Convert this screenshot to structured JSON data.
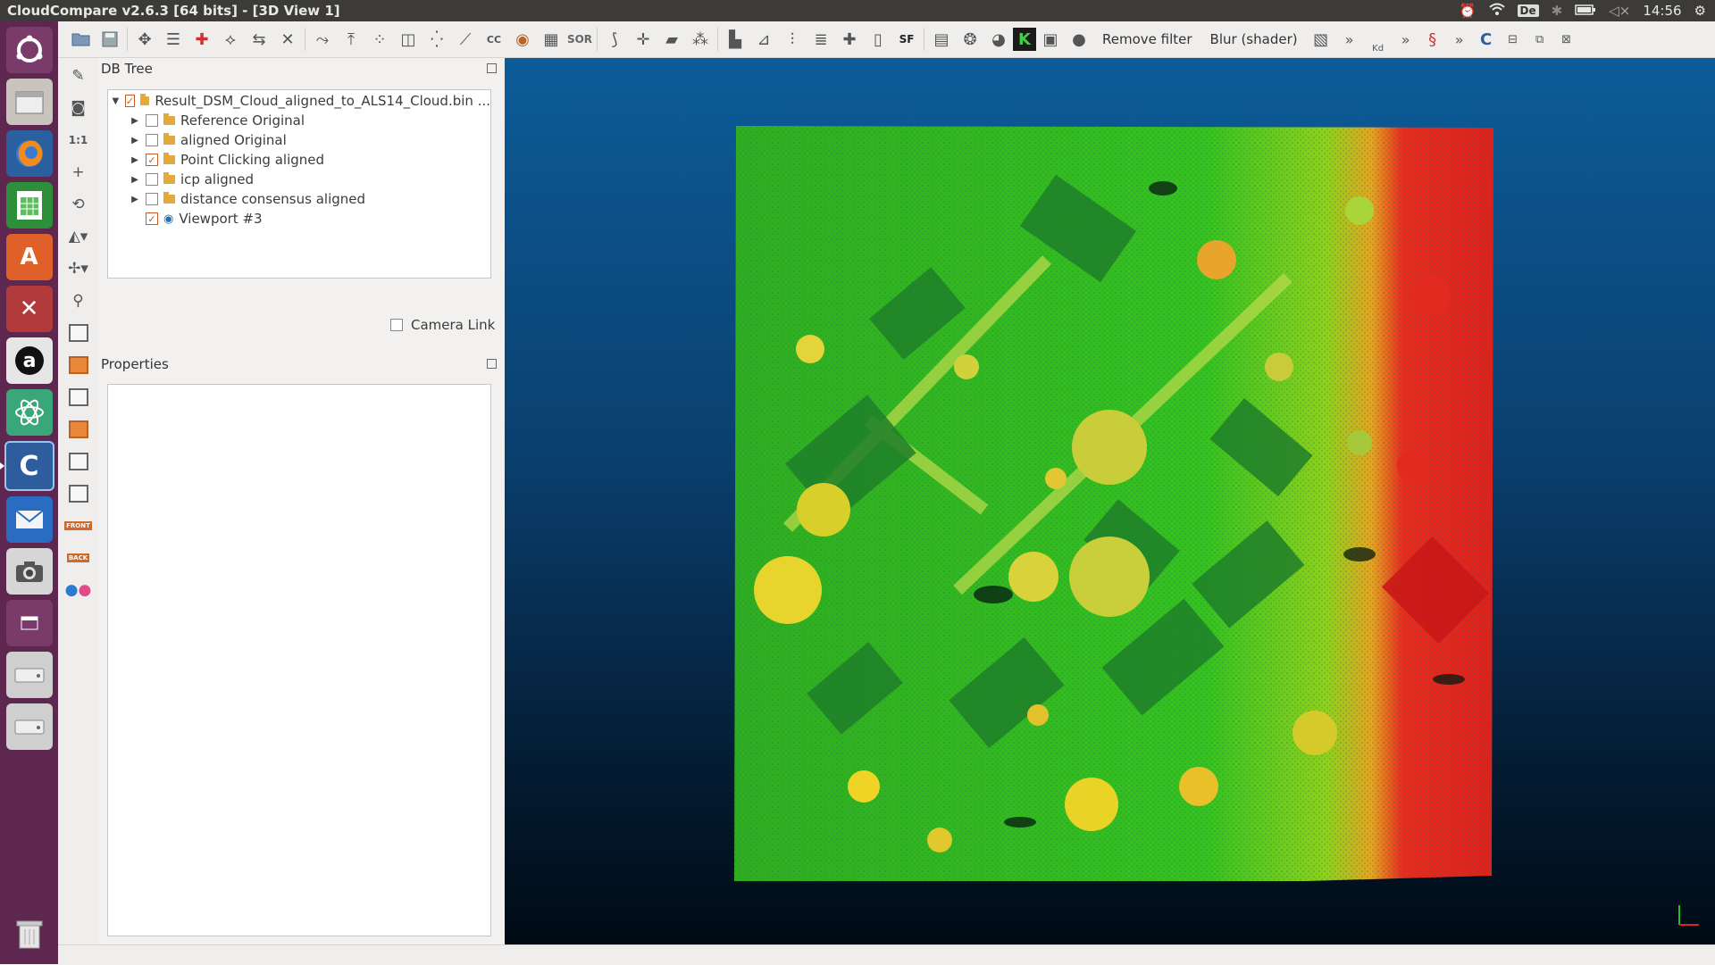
{
  "window": {
    "title": "CloudCompare v2.6.3 [64 bits] - [3D View 1]",
    "clock": "14:56",
    "keyboard_layout": "De"
  },
  "toolbar": {
    "remove_filter_label": "Remove filter",
    "blur_shader_label": "Blur (shader)",
    "sor_label": "SOR",
    "sf_label": "SF",
    "kd_label": "Kd",
    "more_label": "»"
  },
  "vertical_toolbar": {
    "zoom_1to1_label": "1:1",
    "front_label": "FRONT",
    "back_label": "BACK"
  },
  "db_tree": {
    "title": "DB Tree",
    "root": {
      "label": "Result_DSM_Cloud_aligned_to_ALS14_Cloud.bin ...",
      "checked": true,
      "expanded": true
    },
    "items": [
      {
        "label": "Reference Original",
        "checked": false,
        "type": "folder"
      },
      {
        "label": "aligned Original",
        "checked": false,
        "type": "folder"
      },
      {
        "label": "Point Clicking aligned",
        "checked": true,
        "type": "folder"
      },
      {
        "label": "icp aligned",
        "checked": false,
        "type": "folder"
      },
      {
        "label": "distance consensus aligned",
        "checked": false,
        "type": "folder"
      },
      {
        "label": "Viewport #3",
        "checked": true,
        "type": "viewport"
      }
    ]
  },
  "camera_link": {
    "label": "Camera Link",
    "checked": false
  },
  "properties": {
    "title": "Properties"
  },
  "colors": {
    "accent_checkbox": "#c75a2a",
    "launcher_bg": "#5e2750",
    "view_bg_top": "#0d5c99",
    "view_bg_bottom": "#000a14"
  }
}
